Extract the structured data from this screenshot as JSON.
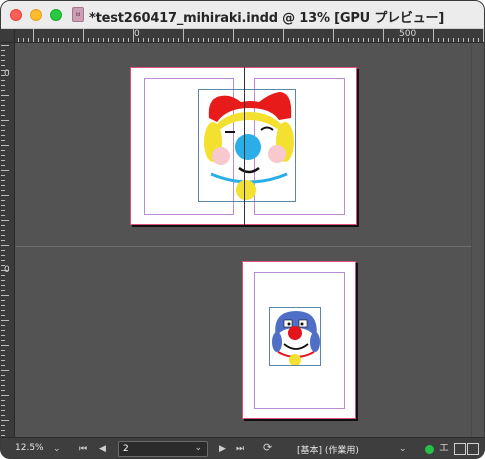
{
  "window": {
    "title": "*test260417_mihiraki.indd @ 13% [GPU プレビュー]",
    "doc_icon_label": "Id"
  },
  "ruler": {
    "h_label_0": "0",
    "h_label_500": "500",
    "v_label_top": "0",
    "v_label_bottom": "0"
  },
  "statusbar": {
    "zoom": "12.5%",
    "page_number": "2",
    "first_page_icon": "first-page-icon",
    "prev_page_icon": "prev-page-icon",
    "next_page_icon": "next-page-icon",
    "last_page_icon": "last-page-icon",
    "page_dropdown_icon": "chevron-down-icon",
    "zoom_dropdown_icon": "chevron-down-icon",
    "preflight_profile": "[基本] (作業用)",
    "preflight_status_color": "#25c146"
  },
  "colors": {
    "pasteboard": "#535353",
    "bleed_guide": "#e0507a",
    "margin_guide": "#b98bd3",
    "frame_edge": "#5a86a8"
  }
}
